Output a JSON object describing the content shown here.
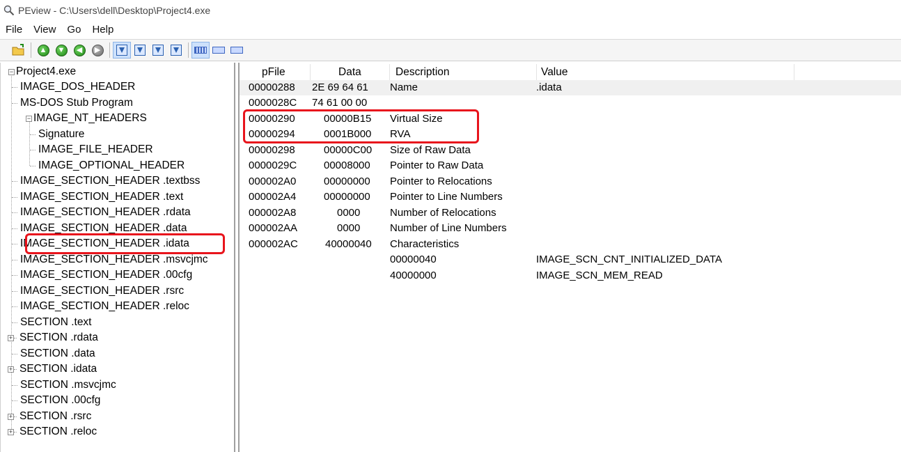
{
  "window": {
    "title": "PEview - C:\\Users\\dell\\Desktop\\Project4.exe"
  },
  "menu": [
    "File",
    "View",
    "Go",
    "Help"
  ],
  "toolbar": {
    "icons": [
      "open-file-icon",
      "nav-back-icon",
      "nav-forward-icon",
      "nav-up-icon",
      "nav-previous-icon",
      "view-doc-icon-1",
      "view-doc-icon-2",
      "view-doc-icon-3",
      "view-doc-icon-4",
      "view-mode-byte-icon",
      "view-mode-word-icon",
      "view-mode-dword-icon"
    ],
    "accent": "#1f8a17"
  },
  "tree": {
    "root": "Project4.exe",
    "items": [
      {
        "label": "IMAGE_DOS_HEADER"
      },
      {
        "label": "MS-DOS Stub Program"
      },
      {
        "label": "IMAGE_NT_HEADERS"
      },
      {
        "label": "Signature"
      },
      {
        "label": "IMAGE_FILE_HEADER"
      },
      {
        "label": "IMAGE_OPTIONAL_HEADER"
      },
      {
        "label": "IMAGE_SECTION_HEADER .textbss"
      },
      {
        "label": "IMAGE_SECTION_HEADER .text"
      },
      {
        "label": "IMAGE_SECTION_HEADER .rdata"
      },
      {
        "label": "IMAGE_SECTION_HEADER .data"
      },
      {
        "label": "IMAGE_SECTION_HEADER .idata"
      },
      {
        "label": "IMAGE_SECTION_HEADER .msvcjmc"
      },
      {
        "label": "IMAGE_SECTION_HEADER .00cfg"
      },
      {
        "label": "IMAGE_SECTION_HEADER .rsrc"
      },
      {
        "label": "IMAGE_SECTION_HEADER .reloc"
      },
      {
        "label": "SECTION .text"
      },
      {
        "label": "SECTION .rdata"
      },
      {
        "label": "SECTION .data"
      },
      {
        "label": "SECTION .idata"
      },
      {
        "label": "SECTION .msvcjmc"
      },
      {
        "label": "SECTION .00cfg"
      },
      {
        "label": "SECTION .rsrc"
      },
      {
        "label": "SECTION .reloc"
      }
    ],
    "selected": "IMAGE_SECTION_HEADER .idata"
  },
  "details": {
    "columns": [
      "pFile",
      "Data",
      "Description",
      "Value"
    ],
    "rows": [
      {
        "pfile": "00000288",
        "data": "2E 69 64 61",
        "desc": "Name",
        "value": ".idata"
      },
      {
        "pfile": "0000028C",
        "data": "74 61 00 00",
        "desc": "",
        "value": ""
      },
      {
        "pfile": "00000290",
        "data": "00000B15",
        "desc": "Virtual Size",
        "value": ""
      },
      {
        "pfile": "00000294",
        "data": "0001B000",
        "desc": "RVA",
        "value": ""
      },
      {
        "pfile": "00000298",
        "data": "00000C00",
        "desc": "Size of Raw Data",
        "value": ""
      },
      {
        "pfile": "0000029C",
        "data": "00008000",
        "desc": "Pointer to Raw Data",
        "value": ""
      },
      {
        "pfile": "000002A0",
        "data": "00000000",
        "desc": "Pointer to Relocations",
        "value": ""
      },
      {
        "pfile": "000002A4",
        "data": "00000000",
        "desc": "Pointer to Line Numbers",
        "value": ""
      },
      {
        "pfile": "000002A8",
        "data": "0000",
        "desc": "Number of Relocations",
        "value": ""
      },
      {
        "pfile": "000002AA",
        "data": "0000",
        "desc": "Number of Line Numbers",
        "value": ""
      },
      {
        "pfile": "000002AC",
        "data": "40000040",
        "desc": "Characteristics",
        "value": ""
      },
      {
        "pfile": "",
        "data": "",
        "desc": "00000040",
        "value": "IMAGE_SCN_CNT_INITIALIZED_DATA"
      },
      {
        "pfile": "",
        "data": "",
        "desc": "40000000",
        "value": "IMAGE_SCN_MEM_READ"
      }
    ]
  },
  "highlight_color": "#e8141c"
}
